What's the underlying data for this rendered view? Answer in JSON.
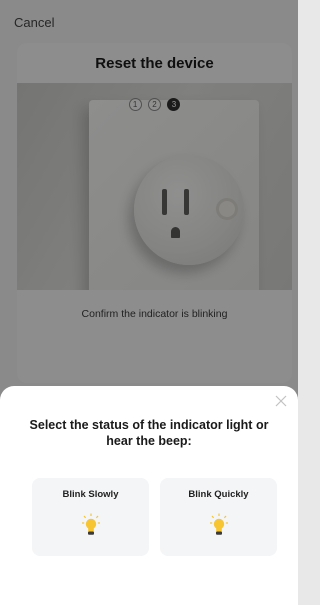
{
  "header": {
    "cancel_label": "Cancel"
  },
  "card": {
    "title": "Reset the device",
    "steps": [
      "1",
      "2",
      "3"
    ],
    "active_step": 3,
    "confirm_text": "Confirm the indicator is blinking"
  },
  "sheet": {
    "title": "Select the status of the indicator light or hear the beep:",
    "options": [
      {
        "label": "Blink Slowly",
        "icon": "lightbulb-icon"
      },
      {
        "label": "Blink Quickly",
        "icon": "lightbulb-icon"
      }
    ]
  },
  "colors": {
    "overlay": "#000000",
    "bulb": "#f7c531",
    "bulb_base": "#3a3a3a"
  }
}
